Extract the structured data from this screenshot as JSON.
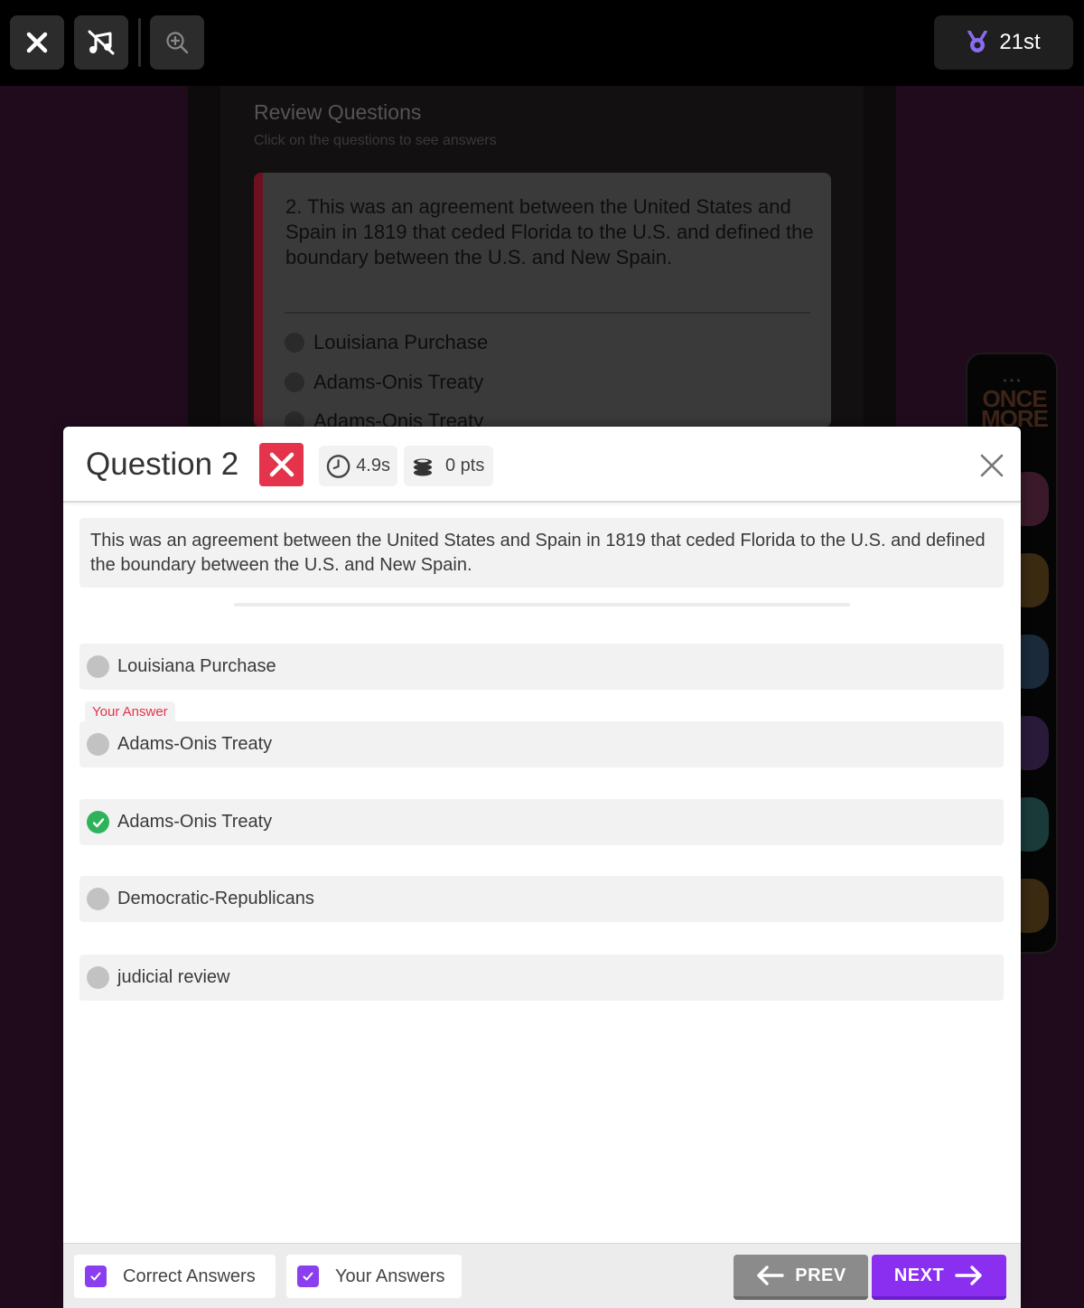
{
  "topbar": {
    "close_icon": "close-icon",
    "music_icon": "music-off-icon",
    "zoom_icon": "zoom-in-icon",
    "rank": "21st",
    "rank_icon": "medal-icon"
  },
  "review": {
    "title": "Review Questions",
    "subtitle": "Click on the questions to see answers",
    "card": {
      "question": "2.   This was an agreement between the United States and Spain in 1819 that ceded Florida to the U.S. and defined the boundary between the U.S. and New Spain.",
      "options": [
        "Louisiana Purchase",
        "Adams-Onis Treaty",
        "Adams-Onis Treaty"
      ]
    }
  },
  "side_panel": {
    "label": "ONCE MORE"
  },
  "modal": {
    "title": "Question 2",
    "status_icon": "wrong-x-icon",
    "time": "4.9s",
    "points": "0 pts",
    "question_text": "This was an agreement between the United States and Spain in 1819 that ceded Florida to the U.S. and defined the boundary between the U.S. and New Spain.",
    "your_answer_label": "Your Answer",
    "options": [
      {
        "text": "Louisiana Purchase",
        "state": "neutral"
      },
      {
        "text": "Adams-Onis Treaty",
        "state": "your-answer"
      },
      {
        "text": "Adams-Onis Treaty",
        "state": "correct"
      },
      {
        "text": "Democratic-Republicans",
        "state": "neutral"
      },
      {
        "text": "judicial review",
        "state": "neutral"
      }
    ],
    "footer": {
      "correct_answers_label": "Correct Answers",
      "correct_answers_checked": true,
      "your_answers_label": "Your Answers",
      "your_answers_checked": true,
      "prev_label": "PREV",
      "next_label": "NEXT"
    }
  },
  "colors": {
    "accent_purple": "#8a2ef0",
    "wrong_red": "#e4334b",
    "correct_green": "#2fb35a"
  }
}
